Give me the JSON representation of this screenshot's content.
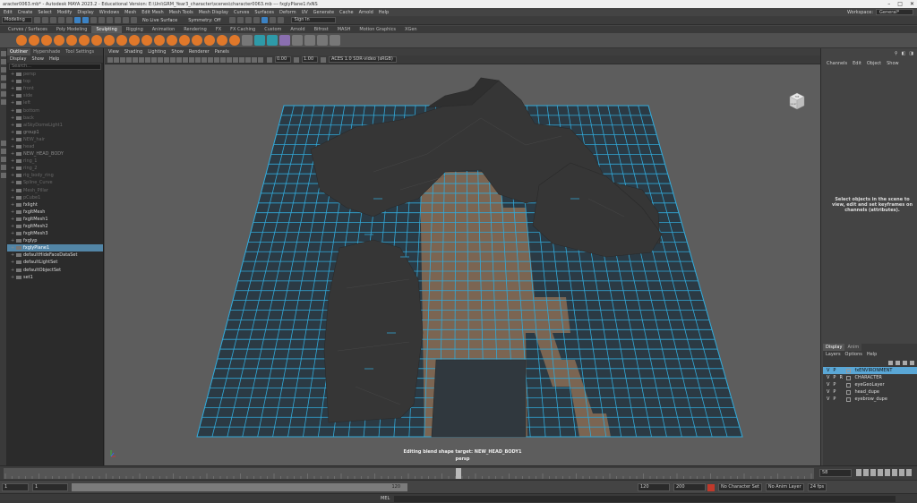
{
  "window": {
    "title": "aracter0063.mb* - Autodesk MAYA 2023.2 - Educational Version: E:\\Uni\\GRM_Year3_character\\scenes\\character0063.mb --- fxglyPlane1:fxNS"
  },
  "menubar": {
    "items": [
      "Edit",
      "Create",
      "Select",
      "Modify",
      "Display",
      "Windows",
      "Mesh",
      "Edit Mesh",
      "Mesh Tools",
      "Mesh Display",
      "Curves",
      "Surfaces",
      "Deform",
      "UV",
      "Generate",
      "Cache",
      "Arnold",
      "Help"
    ],
    "workspace_label": "Workspace:",
    "workspace_value": "General*"
  },
  "statusline": {
    "mode": "Modeling",
    "live_surface": "No Live Surface",
    "symmetry": "Symmetry: Off",
    "sign_in": "Sign In"
  },
  "shelf": {
    "tabs": [
      "Curves / Surfaces",
      "Poly Modeling",
      "Sculpting",
      "Rigging",
      "Animation",
      "Rendering",
      "FX",
      "FX Caching",
      "Custom",
      "Arnold",
      "Bifrost",
      "MASH",
      "Motion Graphics",
      "XGen"
    ],
    "active_tab": "Sculpting"
  },
  "outliner": {
    "tabs": [
      "Outliner",
      "Hypershade",
      "Tool Settings"
    ],
    "menu": [
      "Display",
      "Show",
      "Help"
    ],
    "search_placeholder": "Search...",
    "rows": [
      {
        "label": "persp",
        "style": "dim"
      },
      {
        "label": "top",
        "style": "dim"
      },
      {
        "label": "front",
        "style": "dim"
      },
      {
        "label": "side",
        "style": "dim"
      },
      {
        "label": "left",
        "style": "dim"
      },
      {
        "label": "bottom",
        "style": "dim"
      },
      {
        "label": "back",
        "style": "dim"
      },
      {
        "label": "aiSkyDomeLight1",
        "style": "dim"
      },
      {
        "label": "group1",
        "style": "normal"
      },
      {
        "label": "NEW_hair",
        "style": "dim"
      },
      {
        "label": "head",
        "style": "dim"
      },
      {
        "label": "NEW_HEAD_BODY",
        "style": "normal"
      },
      {
        "label": "ring_1",
        "style": "dim"
      },
      {
        "label": "ring_2",
        "style": "dim"
      },
      {
        "label": "rig_body_ring",
        "style": "dim"
      },
      {
        "label": "Spline_Curve",
        "style": "dim"
      },
      {
        "label": "Mesh_Pillar",
        "style": "dim"
      },
      {
        "label": "pCube1",
        "style": "dim"
      },
      {
        "label": "fxlight",
        "style": "bright"
      },
      {
        "label": "fxgltMesh",
        "style": "bright"
      },
      {
        "label": "fxgltMesh1",
        "style": "bright"
      },
      {
        "label": "fxgltMesh2",
        "style": "bright"
      },
      {
        "label": "fxgltMesh3",
        "style": "bright"
      },
      {
        "label": "fxglyp",
        "style": "bright"
      },
      {
        "label": "fxglyPlane1",
        "style": "selected"
      },
      {
        "label": "defaultHideFaceDataSet",
        "style": "bright"
      },
      {
        "label": "defaultLightSet",
        "style": "bright"
      },
      {
        "label": "defaultObjectSet",
        "style": "bright"
      },
      {
        "label": "set1",
        "style": "bright"
      }
    ]
  },
  "viewport": {
    "menu": [
      "View",
      "Shading",
      "Lighting",
      "Show",
      "Renderer",
      "Panels"
    ],
    "exposure": "0.00",
    "gamma": "1.00",
    "color_space": "ACES 1.0 SDR-video (sRGB)",
    "caption_1": "Editing blend shape target: NEW_HEAD_BODY1",
    "caption_2": "persp",
    "viewcube_top": "TOP",
    "viewcube_front": "FRONT"
  },
  "channelbox": {
    "menu": [
      "Channels",
      "Edit",
      "Object",
      "Show"
    ],
    "message": "Select objects in the scene to view, edit and set keyframes on channels (attributes)."
  },
  "layers": {
    "tabs": [
      "Display",
      "Anim"
    ],
    "menu": [
      "Layers",
      "Options",
      "Help"
    ],
    "rows": [
      {
        "v": "V",
        "p": "P",
        "r": "",
        "name": "fxENVIRONMENT",
        "selected": true
      },
      {
        "v": "V",
        "p": "P",
        "r": "R",
        "name": "CHARACTER",
        "selected": false
      },
      {
        "v": "V",
        "p": "P",
        "r": "",
        "name": "eyeGeoLayer",
        "selected": false
      },
      {
        "v": "V",
        "p": "P",
        "r": "",
        "name": "head_dupe",
        "selected": false
      },
      {
        "v": "V",
        "p": "P",
        "r": "",
        "name": "eyebrow_dupe",
        "selected": false
      }
    ]
  },
  "timeslider": {
    "current_frame": "58"
  },
  "rangebar": {
    "start": "1",
    "anim_start": "1",
    "range_end_label": "120",
    "range_end": "120",
    "anim_end": "200",
    "character_set": "No Character Set",
    "anim_layer": "No Anim Layer",
    "fps": "24 fps"
  },
  "cmdline": {
    "mel": "MEL"
  },
  "colors": {
    "grid_blue": "#31a9d9",
    "selection": "#5285a6",
    "layer_selected": "#5aa7d6",
    "shelf_orange": "#e0782a"
  }
}
